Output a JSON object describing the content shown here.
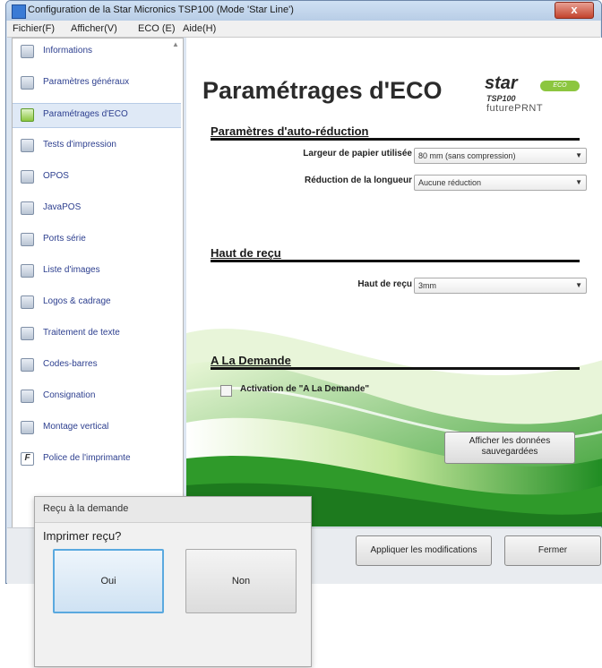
{
  "window": {
    "title": "Configuration de la Star Micronics TSP100 (Mode 'Star Line')",
    "close_label": "x"
  },
  "menu": [
    "Fichier(F)",
    "Afficher(V)",
    "ECO (E)",
    "Aide(H)"
  ],
  "sidebar": {
    "items": [
      {
        "label": "Informations",
        "icon": "info-icon"
      },
      {
        "label": "Paramètres généraux",
        "icon": "settings-icon"
      },
      {
        "label": "Paramétrages d'ECO",
        "icon": "eco-icon",
        "selected": true
      },
      {
        "label": "Tests d'impression",
        "icon": "print-test-icon"
      },
      {
        "label": "OPOS",
        "icon": "opos-icon"
      },
      {
        "label": "JavaPOS",
        "icon": "javapos-icon"
      },
      {
        "label": "Ports série",
        "icon": "serial-port-icon"
      },
      {
        "label": "Liste d'images",
        "icon": "image-list-icon"
      },
      {
        "label": "Logos & cadrage",
        "icon": "logo-icon"
      },
      {
        "label": "Traitement de texte",
        "icon": "text-processing-icon"
      },
      {
        "label": "Codes-barres",
        "icon": "barcode-icon"
      },
      {
        "label": "Consignation",
        "icon": "log-icon"
      },
      {
        "label": "Montage vertical",
        "icon": "vertical-mount-icon"
      },
      {
        "label": "Police de l'imprimante",
        "icon": "font-icon"
      }
    ]
  },
  "main": {
    "title": "Paramétrages d'ECO",
    "logo": {
      "brand": "star",
      "eco": "ECO",
      "model": "TSP100",
      "line": "futurePRNT"
    },
    "auto_reduction": {
      "title": "Paramètres d'auto-réduction",
      "paper_width_label": "Largeur de papier utilisée",
      "paper_width_value": "80 mm (sans compression)",
      "length_reduction_label": "Réduction de la longueur",
      "length_reduction_value": "Aucune réduction"
    },
    "receipt_top": {
      "title": "Haut de reçu",
      "label": "Haut de reçu",
      "value": "3mm"
    },
    "on_demand": {
      "title": "A La Demande",
      "checkbox_label": "Activation de \"A La Demande\"",
      "checked": false
    },
    "show_saved_button": "Afficher les données sauvegardées"
  },
  "footer": {
    "apply_button": "Appliquer les modifications",
    "close_button": "Fermer"
  },
  "dialog": {
    "title": "Reçu à la demande",
    "prompt": "Imprimer reçu?",
    "yes_button": "Oui",
    "no_button": "Non"
  },
  "colors": {
    "wave_green": "#2f9a2a",
    "wave_light": "#b9e08a",
    "logo_eco": "#8cc63f",
    "selection": "#dfe9f6",
    "dialog_focus": "#5aa9df"
  }
}
